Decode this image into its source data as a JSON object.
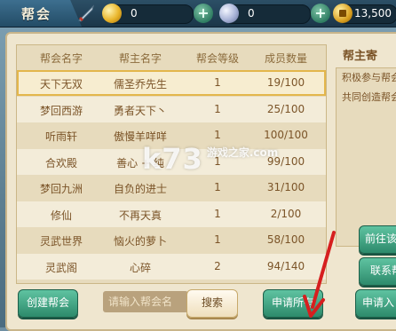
{
  "topbar": {
    "title": "帮会",
    "resources": [
      {
        "icon": "gold-ingot-icon",
        "value": "0"
      },
      {
        "icon": "silver-ingot-icon",
        "value": "0"
      },
      {
        "icon": "yuanbao-coin-icon",
        "value": "13500"
      }
    ]
  },
  "guild_list": {
    "headers": [
      "帮会名字",
      "帮主名字",
      "帮会等级",
      "成员数量"
    ],
    "rows": [
      {
        "name": "天下无双",
        "leader": "儒圣乔先生",
        "level": "1",
        "members": "19/100"
      },
      {
        "name": "梦回西游",
        "leader": "勇者天下丶",
        "level": "1",
        "members": "25/100"
      },
      {
        "name": "听雨轩",
        "leader": "傲慢羊咩咩",
        "level": "1",
        "members": "100/100"
      },
      {
        "name": "合欢殿",
        "leader": "善心 + 纯",
        "level": "1",
        "members": "99/100"
      },
      {
        "name": "梦回九洲",
        "leader": "自负的进士",
        "level": "1",
        "members": "31/100"
      },
      {
        "name": "修仙",
        "leader": "不再天真",
        "level": "1",
        "members": "2/100"
      },
      {
        "name": "灵武世界",
        "leader": "恼火的萝卜",
        "level": "1",
        "members": "58/100"
      },
      {
        "name": "灵武阁",
        "leader": "心碎",
        "level": "2",
        "members": "94/140"
      }
    ]
  },
  "side_panel": {
    "title": "帮主寄",
    "text_lines": [
      "积极参与帮会",
      "共同创造帮会"
    ],
    "goto_button": "前往该帮",
    "contact_button": "联系帮"
  },
  "bottom": {
    "create_button": "创建帮会",
    "search_placeholder": "请输入帮会名",
    "search_button": "搜索",
    "apply_all_button": "申请所有",
    "apply_join_button": "申请入"
  },
  "watermark": {
    "main": "k73",
    "sub": "游戏之家",
    "domain": ".com"
  }
}
